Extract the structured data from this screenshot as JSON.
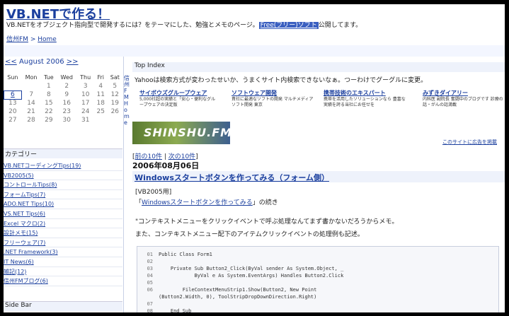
{
  "header": {
    "title": "VB.NETで作る！",
    "desc_before": "VB.NETをオブジェクト指向型で開発するには？をテーマにした、勉強とメモのページ。",
    "desc_highlight": "Free(フリー)ソフト",
    "desc_after": "公開してます。",
    "breadcrumb_site": "信州FM",
    "breadcrumb_sep": " > ",
    "breadcrumb_home": "Home"
  },
  "calendar": {
    "prev": "<<",
    "month": "August 2006",
    "next": ">>",
    "weekdays": [
      "Sun",
      "Mon",
      "Tue",
      "Wed",
      "Thu",
      "Fri",
      "Sat"
    ],
    "weeks": [
      [
        "",
        "",
        "1",
        "2",
        "3",
        "4",
        "5"
      ],
      [
        "6",
        "7",
        "8",
        "9",
        "10",
        "11",
        "12"
      ],
      [
        "13",
        "14",
        "15",
        "16",
        "17",
        "18",
        "19"
      ],
      [
        "20",
        "21",
        "22",
        "23",
        "24",
        "25",
        "26"
      ],
      [
        "27",
        "28",
        "29",
        "30",
        "31",
        "",
        ""
      ]
    ],
    "today": "6"
  },
  "categories": {
    "title": "カテゴリー",
    "items": [
      "VB.NETコーディングTips(19)",
      "VB2005(5)",
      "コントロールTips(8)",
      "フォームTips(7)",
      "ADO.NET Tips(10)",
      "VS.NET Tips(6)",
      "Excel マクロ(2)",
      "設計メモ(15)",
      "フリーウェア(7)",
      ".NET Framework(3)",
      "IT News(6)",
      "雑記(12)",
      "信州FMブログ(6)"
    ]
  },
  "sidebar": {
    "title": "Side Bar"
  },
  "midcol": {
    "lines": [
      "信",
      "州",
      "F",
      "M",
      " ",
      "H",
      "o",
      "m",
      "e"
    ]
  },
  "main": {
    "top_index": "Top Index",
    "news": "Yahooは検索方式が変わったせいか、うまくサイト内検索できないなぁ。つーわけでグーグルに変更。",
    "ads": [
      {
        "title": "サイボウズグループウェア",
        "desc1": "5,000社超の実績と「安心・便利なグル",
        "desc2": "ープウェアの決定版"
      },
      {
        "title": "ソフトウェア開発",
        "desc1": "貴社に最適なソフトの開発 マルチメディア",
        "desc2": "ソフト開発 東京"
      },
      {
        "title": "携帯技術のエキスパート",
        "desc1": "携帯を活用したソリューションなら 豊富な",
        "desc2": "実績を誇る当社にお任せを"
      },
      {
        "title": "みずきダイアリー",
        "desc1": "内科医 副院長 奮闘中のブログです 診療の",
        "desc2": "話・がんの話満載"
      }
    ],
    "banner": "SHINSHU.FM",
    "ad_link": "このサイトに広告を掲載",
    "pager_open": "[",
    "pager_prev": "前の10件",
    "pager_sep": " | ",
    "pager_next": "次の10件",
    "pager_close": "]",
    "post_date": "2006年08月06日",
    "post_title": "Windowsスタートボタンを作ってみる（フォーム側）",
    "post_tag": "[VB2005用]",
    "post_cont_open": "「",
    "post_cont_link": "Windowsスタートボタンを作ってみる",
    "post_cont_close": "」の続き",
    "post_p1": "\"コンテキストメニューをクリックイベントで呼ぶ処理なんてまず書かないだろうからメモ。",
    "post_p2": "また、コンテキストメニュー配下のアイテムクリックイベントの処理例も記述。"
  },
  "code": [
    {
      "n": "01",
      "t": "Public Class Form1"
    },
    {
      "n": "02",
      "t": ""
    },
    {
      "n": "03",
      "t": "    Private Sub Button2_Click(ByVal sender As System.Object, _"
    },
    {
      "n": "04",
      "t": "            ByVal e As System.EventArgs) Handles Button2.Click"
    },
    {
      "n": "05",
      "t": ""
    },
    {
      "n": "06",
      "t": "        FileContextMenuStrip1.Show(Button2, New Point"
    },
    {
      "n": "",
      "t": "(Button2.Width, 0), ToolStripDropDownDirection.Right)"
    },
    {
      "n": "07",
      "t": ""
    },
    {
      "n": "08",
      "t": "    End Sub"
    }
  ],
  "colors": {
    "link": "#1b3f9e",
    "section_bg": "#eef2fb",
    "highlight": "#3a5fc0"
  }
}
